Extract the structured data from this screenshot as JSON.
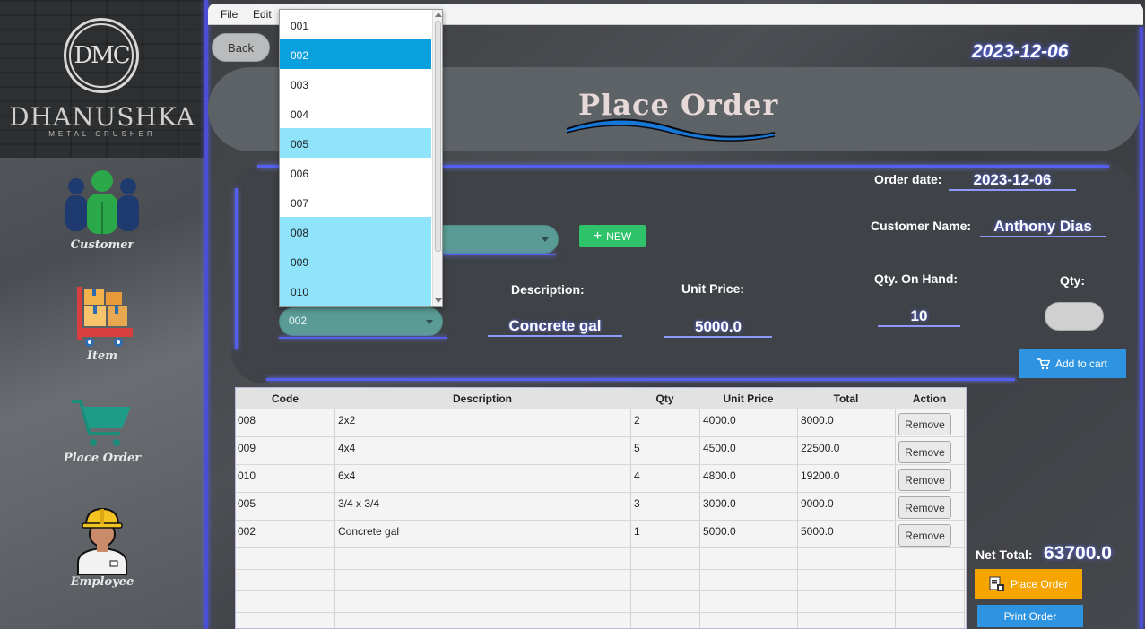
{
  "menu": {
    "file": "File",
    "edit": "Edit"
  },
  "back_label": "Back",
  "current_date": "2023-12-06",
  "page_title": "Place Order",
  "logo": {
    "monogram": "DMC",
    "name": "DHANUSHKA",
    "subtitle": "METAL CRUSHER"
  },
  "sidebar": {
    "items": [
      {
        "label": "Customer",
        "icon": "customer-group-icon"
      },
      {
        "label": "Item",
        "icon": "item-boxes-cart-icon"
      },
      {
        "label": "Place Order",
        "icon": "shopping-cart-icon"
      },
      {
        "label": "Employee",
        "icon": "employee-worker-icon"
      }
    ]
  },
  "order": {
    "order_date_label": "Order date:",
    "order_date": "2023-12-06",
    "customer_name_label": "Customer Name:",
    "customer_name": "Anthony Dias",
    "qty_on_hand_label": "Qty. On Hand:",
    "qty_on_hand": "10",
    "qty_label": "Qty:",
    "description_label": "Description:",
    "description": "Concrete gal",
    "unit_price_label": "Unit Price:",
    "unit_price": "5000.0",
    "item_code_selected": "002",
    "new_button": "NEW",
    "add_to_cart": "Add to cart"
  },
  "dropdown": {
    "options": [
      "001",
      "002",
      "003",
      "004",
      "005",
      "006",
      "007",
      "008",
      "009",
      "010"
    ],
    "selected": "002",
    "highlighted": [
      "005",
      "008",
      "009",
      "010"
    ]
  },
  "table": {
    "columns": [
      "Code",
      "Description",
      "Qty",
      "Unit Price",
      "Total",
      "Action"
    ],
    "rows": [
      {
        "code": "008",
        "description": "2x2",
        "qty": "2",
        "unit_price": "4000.0",
        "total": "8000.0",
        "action": "Remove"
      },
      {
        "code": "009",
        "description": "4x4",
        "qty": "5",
        "unit_price": "4500.0",
        "total": "22500.0",
        "action": "Remove"
      },
      {
        "code": "010",
        "description": "6x4",
        "qty": "4",
        "unit_price": "4800.0",
        "total": "19200.0",
        "action": "Remove"
      },
      {
        "code": "005",
        "description": "3/4 x 3/4",
        "qty": "3",
        "unit_price": "3000.0",
        "total": "9000.0",
        "action": "Remove"
      },
      {
        "code": "002",
        "description": "Concrete gal",
        "qty": "1",
        "unit_price": "5000.0",
        "total": "5000.0",
        "action": "Remove"
      }
    ]
  },
  "net_total_label": "Net Total:",
  "net_total": "63700.0",
  "place_order_button": "Place Order",
  "print_order_button": "Print Order",
  "colors": {
    "accent_glow": "#5560f0",
    "new_button": "#2ec36b",
    "add_to_cart": "#2e93e0",
    "place_order": "#f6a400",
    "dropdown_selected": "#0aa0dd",
    "dropdown_highlight": "#8fe3fb"
  }
}
